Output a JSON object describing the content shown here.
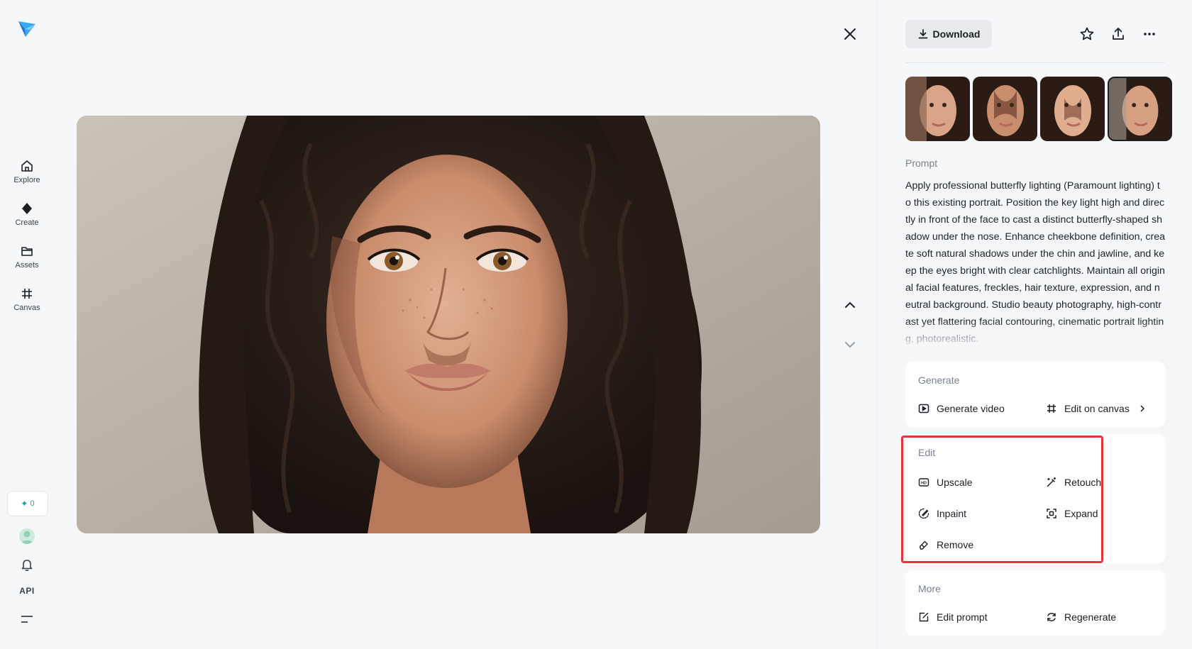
{
  "nav": {
    "items": [
      {
        "label": "Explore",
        "icon": "home-icon"
      },
      {
        "label": "Create",
        "icon": "diamond-icon"
      },
      {
        "label": "Assets",
        "icon": "folder-icon"
      },
      {
        "label": "Canvas",
        "icon": "canvas-icon"
      }
    ],
    "credits": "0",
    "api_label": "API"
  },
  "toolbar": {
    "download_label": "Download"
  },
  "prompt": {
    "label": "Prompt",
    "text": "Apply professional butterfly lighting (Paramount lighting) to this existing portrait. Position the key light high and directly in front of the face to cast a distinct butterfly-shaped shadow under the nose. Enhance cheekbone definition, create soft natural shadows under the chin and jawline, and keep the eyes bright with clear catchlights. Maintain all original facial features, freckles, hair texture, expression, and neutral background. Studio beauty photography, high-contrast yet flattering facial contouring, cinematic portrait lighting, photorealistic."
  },
  "generate": {
    "title": "Generate",
    "generate_video": "Generate video",
    "edit_on_canvas": "Edit on canvas"
  },
  "edit": {
    "title": "Edit",
    "upscale": "Upscale",
    "retouch": "Retouch",
    "inpaint": "Inpaint",
    "expand": "Expand",
    "remove": "Remove"
  },
  "more": {
    "title": "More",
    "edit_prompt": "Edit prompt",
    "regenerate": "Regenerate"
  },
  "colors": {
    "accent": "#1aa39c",
    "highlight": "#e2353b"
  }
}
